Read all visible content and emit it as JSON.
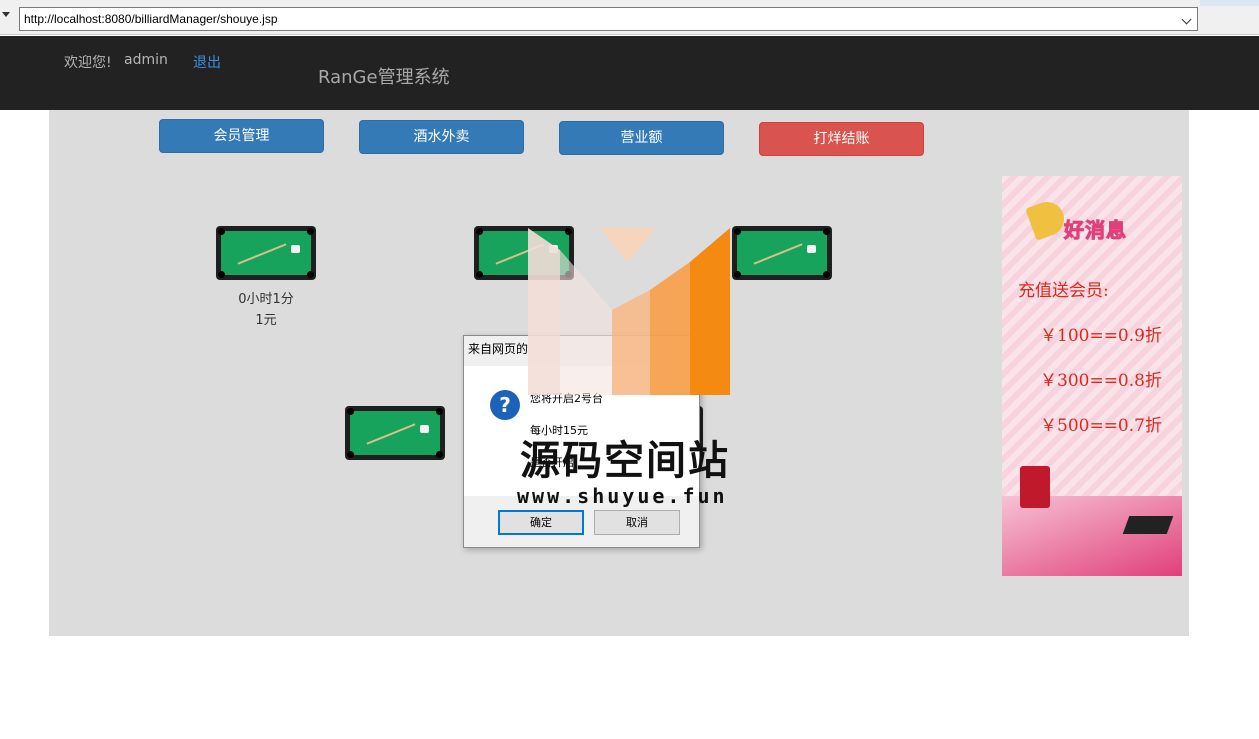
{
  "browser": {
    "url": "http://localhost:8080/billiardManager/shouye.jsp"
  },
  "header": {
    "welcome": "欢迎您!",
    "username": "admin",
    "logout": "退出",
    "brand": "RanGe管理系统"
  },
  "nav": {
    "members": "会员管理",
    "drinks": "酒水外卖",
    "revenue": "营业额",
    "closing": "打烊结账"
  },
  "tables": [
    {
      "duration": "0小时1分",
      "cost": "1元"
    },
    {
      "duration": "",
      "cost": ""
    },
    {
      "duration": "",
      "cost": ""
    },
    {
      "duration": "",
      "cost": ""
    },
    {
      "duration": "",
      "cost": ""
    }
  ],
  "ad": {
    "headline": "好消息",
    "tagline": "充值送会员:",
    "prices": [
      "￥100==0.9折",
      "￥300==0.8折",
      "￥500==0.7折"
    ]
  },
  "dialog": {
    "title": "来自网页的",
    "line1": "您将开启2号台",
    "line2": "每小时15元",
    "line3": "是否开启",
    "ok": "确定",
    "cancel": "取消"
  },
  "watermark": {
    "text": "源码空间站",
    "url": "www.shuyue.fun"
  },
  "colors": {
    "header_bg": "#222222",
    "primary": "#337ab7",
    "danger": "#d9534f",
    "panel_bg": "#dcdcdc",
    "felt": "#18a35c"
  }
}
